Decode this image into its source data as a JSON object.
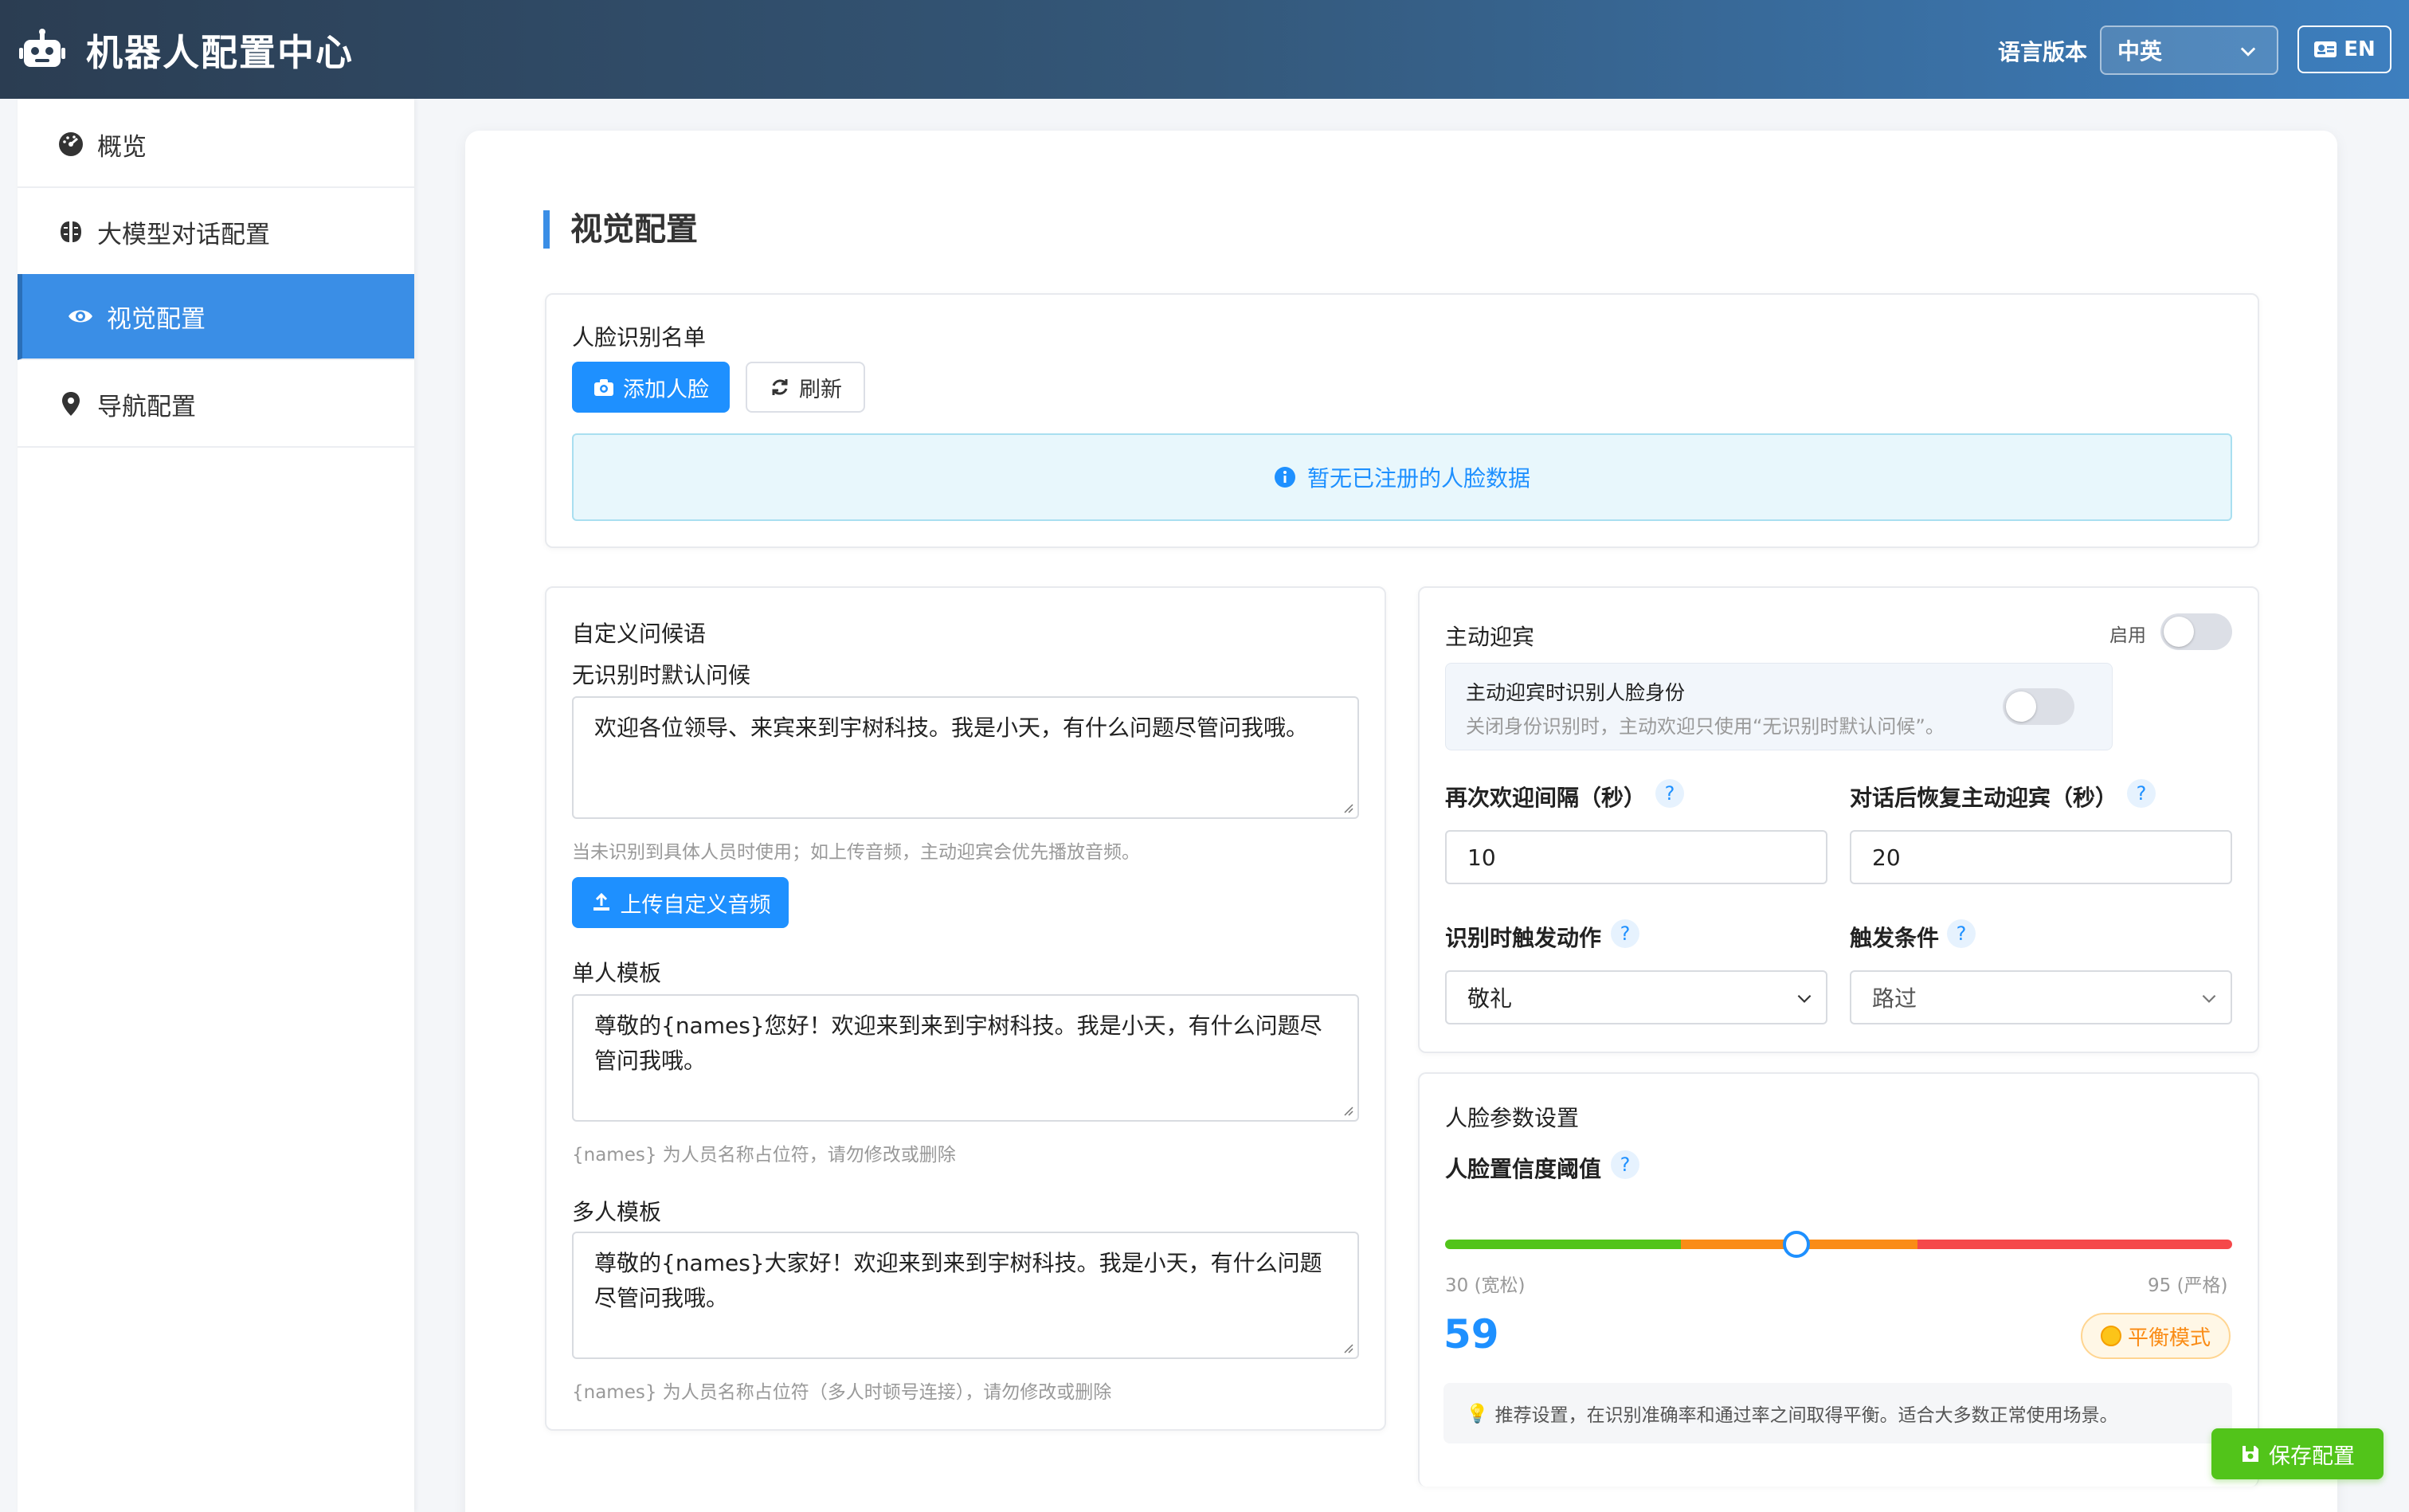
{
  "header": {
    "title": "机器人配置中心",
    "language_label": "语言版本",
    "language_value": "中英",
    "lang_switch_label": "EN"
  },
  "sidebar": {
    "items": [
      {
        "label": "概览",
        "icon": "gauge-icon"
      },
      {
        "label": "大模型对话配置",
        "icon": "brain-icon"
      },
      {
        "label": "视觉配置",
        "icon": "eye-icon",
        "active": true
      },
      {
        "label": "导航配置",
        "icon": "map-pin-icon"
      }
    ]
  },
  "main": {
    "section_title": "视觉配置",
    "face_list": {
      "title": "人脸识别名单",
      "add_button": "添加人脸",
      "refresh_button": "刷新",
      "empty_message": "暂无已注册的人脸数据"
    },
    "greeting": {
      "title": "自定义问候语",
      "default_label": "无识别时默认问候",
      "default_value": "欢迎各位领导、来宾来到宇树科技。我是小天，有什么问题尽管问我哦。",
      "default_hint": "当未识别到具体人员时使用；如上传音频，主动迎宾会优先播放音频。",
      "upload_button": "上传自定义音频",
      "single_label": "单人模板",
      "single_value": "尊敬的{names}您好！欢迎来到来到宇树科技。我是小天，有什么问题尽管问我哦。",
      "single_hint": "{names} 为人员名称占位符，请勿修改或删除",
      "multi_label": "多人模板",
      "multi_value": "尊敬的{names}大家好！欢迎来到来到宇树科技。我是小天，有什么问题尽管问我哦。",
      "multi_hint": "{names} 为人员名称占位符（多人时顿号连接），请勿修改或删除"
    },
    "active_welcome": {
      "title": "主动迎宾",
      "enable_label": "启用",
      "enabled": false,
      "identify_title": "主动迎宾时识别人脸身份",
      "identify_desc": "关闭身份识别时，主动欢迎只使用“无识别时默认问候”。",
      "identify_enabled": false,
      "rewelcome_label": "再次欢迎间隔（秒）",
      "rewelcome_value": "10",
      "resume_label": "对话后恢复主动迎宾（秒）",
      "resume_value": "20",
      "action_label": "识别时触发动作",
      "action_value": "敬礼",
      "condition_label": "触发条件",
      "condition_value": "路过",
      "help_mark": "?"
    },
    "face_params": {
      "title": "人脸参数设置",
      "threshold_label": "人脸置信度阈值",
      "min_label": "30 (宽松)",
      "max_label": "95 (严格)",
      "min": 30,
      "max": 95,
      "value": 59,
      "value_text": "59",
      "mode": "平衡模式",
      "tip_icon": "💡",
      "tip": "推荐设置，在识别准确率和通过率之间取得平衡。适合大多数正常使用场景。"
    },
    "save_button": "保存配置"
  },
  "colors": {
    "accent": "#1e90ff",
    "sidebar_active": "#3a8ee6",
    "save": "#52c41a",
    "slider_green": "#52c41a",
    "slider_orange": "#fa8c16",
    "slider_red": "#f5484a"
  }
}
